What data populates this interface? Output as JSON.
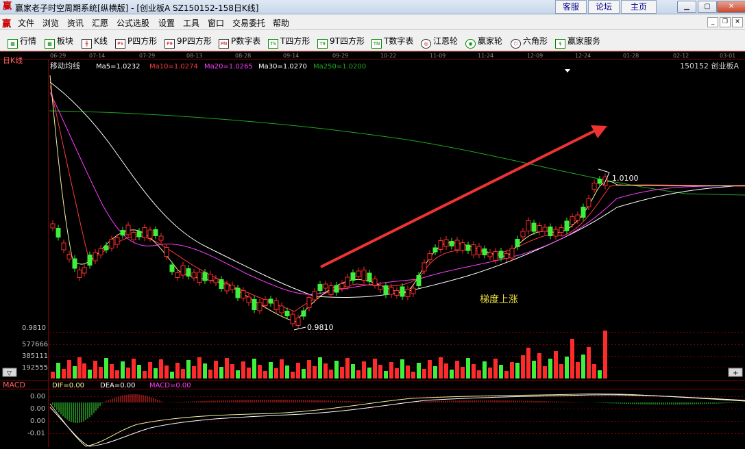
{
  "window": {
    "title": "赢家老子时空周期系统[纵横版] - [创业板A  SZ150152-158日K线]",
    "logo": "赢",
    "top_buttons": [
      "客服",
      "论坛",
      "主页"
    ]
  },
  "menu": {
    "logo": "赢",
    "items": [
      "文件",
      "浏览",
      "资讯",
      "汇愿",
      "公式选股",
      "设置",
      "工具",
      "窗口",
      "交易委托",
      "帮助"
    ]
  },
  "toolbar": {
    "items": [
      {
        "label": "行情",
        "icon": "grid-icon",
        "glyph": "▦"
      },
      {
        "label": "板块",
        "icon": "blocks-icon",
        "glyph": "▩"
      },
      {
        "label": "K线",
        "icon": "kline-icon",
        "glyph": "╫"
      },
      {
        "label": "P四方形",
        "icon": "ps-icon",
        "glyph": "PS"
      },
      {
        "label": "9P四方形",
        "icon": "p9-icon",
        "glyph": "P9"
      },
      {
        "label": "P数字表",
        "icon": "pn-icon",
        "glyph": "PN"
      },
      {
        "label": "T四方形",
        "icon": "ts-icon",
        "glyph": "TS"
      },
      {
        "label": "9T四方形",
        "icon": "t9-icon",
        "glyph": "T9"
      },
      {
        "label": "T数字表",
        "icon": "tn-icon",
        "glyph": "TN"
      },
      {
        "label": "江恩轮",
        "icon": "gann-wheel-icon",
        "glyph": "◎"
      },
      {
        "label": "赢家轮",
        "icon": "winner-wheel-icon",
        "glyph": "◉"
      },
      {
        "label": "六角形",
        "icon": "hexagon-icon",
        "glyph": "⬡"
      },
      {
        "label": "赢家服务",
        "icon": "dollar-icon",
        "glyph": "$"
      }
    ]
  },
  "date_axis": [
    "06-29",
    "07-14",
    "07-29",
    "08-13",
    "08-28",
    "09-14",
    "09-29",
    "10-22",
    "11-09",
    "11-24",
    "12-09",
    "12-24",
    "01-28",
    "02-12",
    "03-01"
  ],
  "main_panel": {
    "period": "日K线",
    "indicator_name": "移动均线",
    "ma_labels": [
      {
        "text": "Ma5=1.0232",
        "color": "#ffffff"
      },
      {
        "text": "Ma10=1.0274",
        "color": "#ff3b3b"
      },
      {
        "text": "Ma20=1.0265",
        "color": "#ff3bff"
      },
      {
        "text": "Ma30=1.0270",
        "color": "#ffffff"
      },
      {
        "text": "Ma250=1.0200",
        "color": "#1fa81f"
      }
    ],
    "stock_label": "150152  创业板A",
    "annotation": "梯度上涨",
    "high_label": "1.0100",
    "low_label": "0.9810",
    "axis_low": "0.9810",
    "colors": {
      "up": "#ff2a2a",
      "down": "#3cf03c",
      "annotation": "#f0e040",
      "arrow": "#ee3333"
    }
  },
  "chart_data": {
    "type": "candlestick",
    "symbol": "150152",
    "name": "创业板A",
    "ma": {
      "ma5": 1.0232,
      "ma10": 1.0274,
      "ma20": 1.0265,
      "ma30": 1.027,
      "ma250": 1.02
    },
    "price_high": 1.01,
    "price_low": 0.981,
    "volume_ticks": [
      577666,
      385111,
      192555
    ],
    "macd": {
      "dif": 0.0,
      "dea": 0.0,
      "macd": 0.0,
      "y_ticks": [
        "0.00",
        "0.00",
        "0.00",
        "-0.01"
      ]
    }
  },
  "volume_panel": {
    "ticks": [
      "577666",
      "385111",
      "192555"
    ]
  },
  "macd_panel": {
    "name": "MACD",
    "dif": "DIF=0.00",
    "dea": "DEA=0.00",
    "macd": "MACD=0.00",
    "ticks": [
      "0.00",
      "0.00",
      "0.00",
      "-0.01"
    ]
  }
}
